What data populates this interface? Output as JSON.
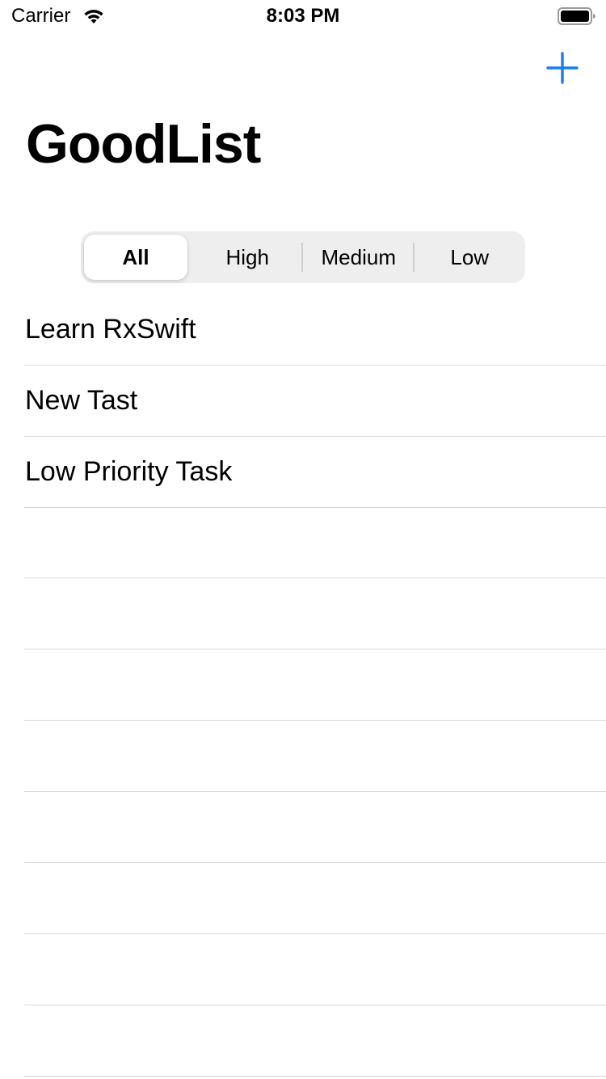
{
  "status_bar": {
    "carrier": "Carrier",
    "time": "8:03 PM",
    "wifi_icon": "wifi-icon",
    "battery_icon": "battery-full-icon"
  },
  "nav": {
    "title": "GoodList",
    "add_icon": "plus-icon",
    "accent_color": "#1a7cf0"
  },
  "filter": {
    "segments": [
      {
        "label": "All",
        "selected": true
      },
      {
        "label": "High",
        "selected": false
      },
      {
        "label": "Medium",
        "selected": false
      },
      {
        "label": "Low",
        "selected": false
      }
    ]
  },
  "tasks": [
    {
      "title": "Learn RxSwift"
    },
    {
      "title": "New Tast"
    },
    {
      "title": "Low Priority Task"
    }
  ]
}
